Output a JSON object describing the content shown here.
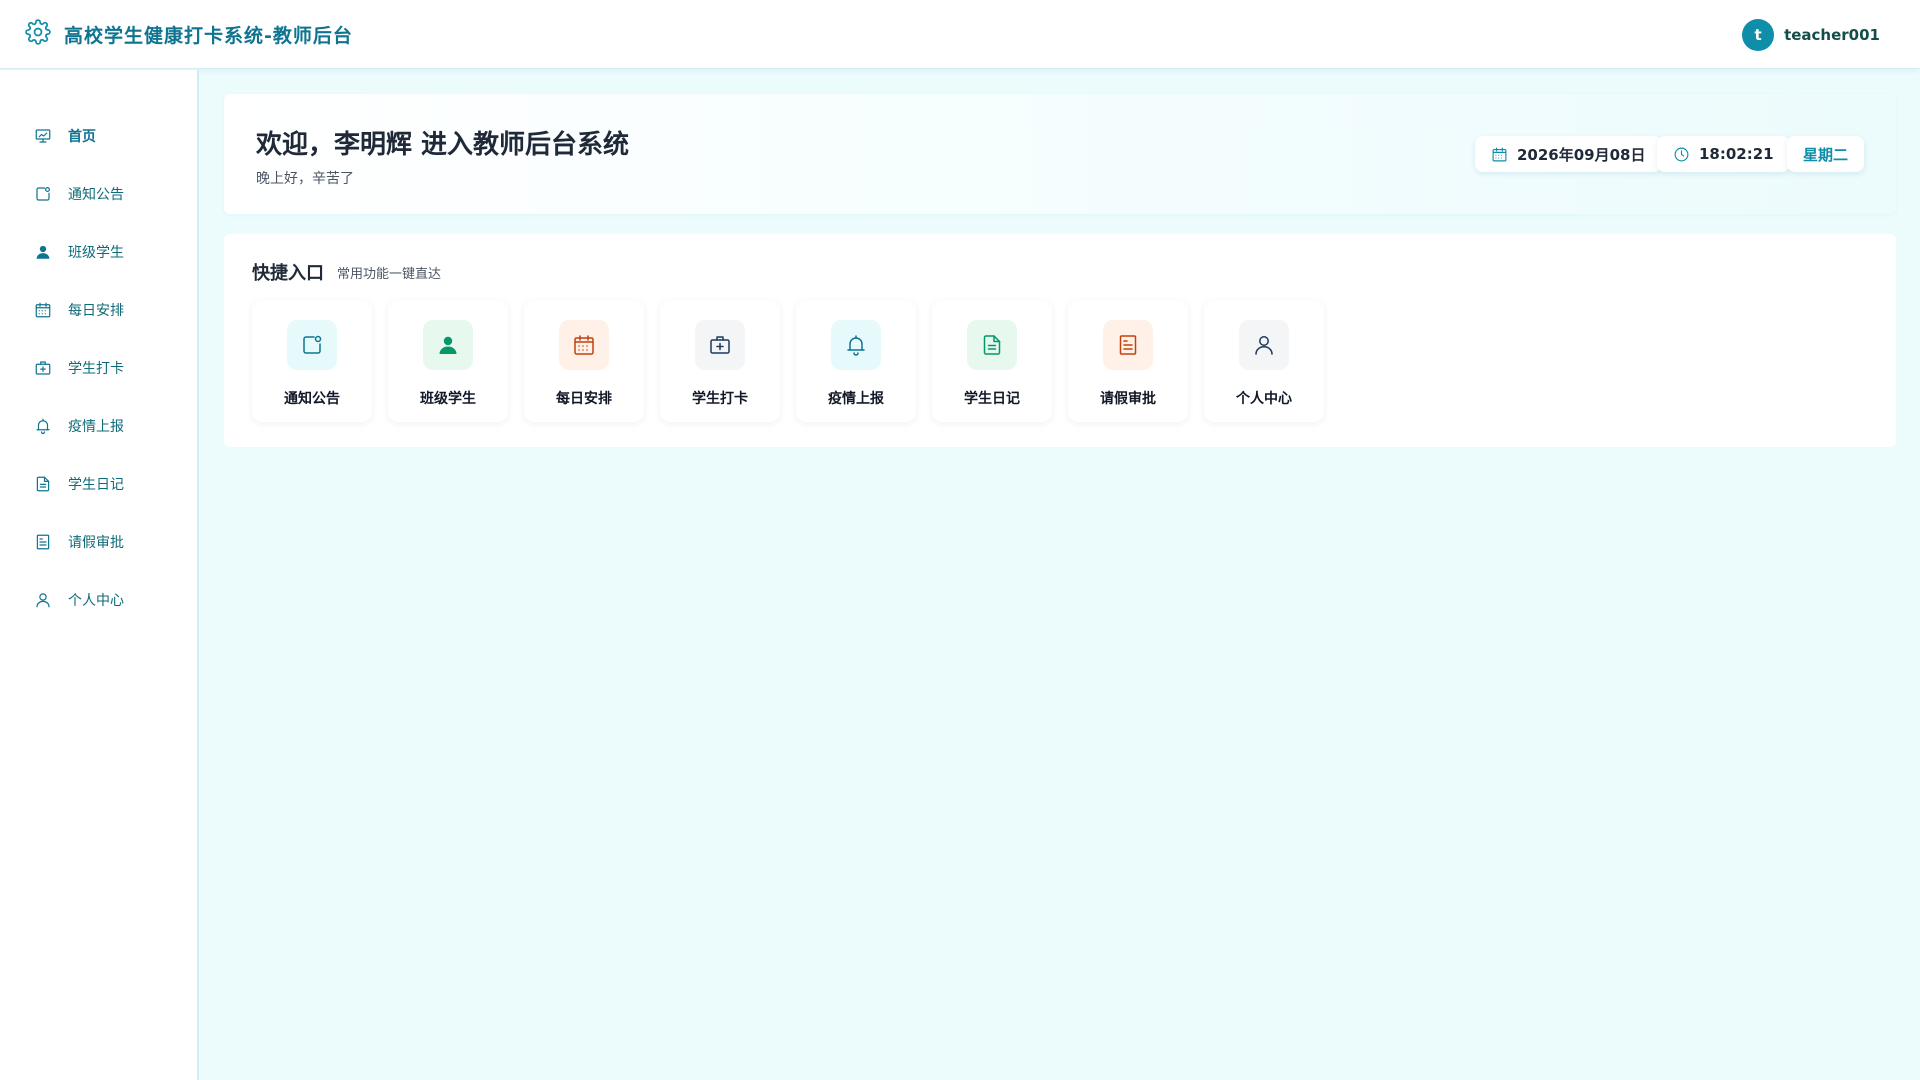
{
  "header": {
    "title": "高校学生健康打卡系统-教师后台",
    "brand_icon": "gear-icon",
    "brand_color": "#0e7490",
    "user": {
      "avatar_letter": "t",
      "name": "teacher001",
      "avatar_color": "#0e8ea8"
    }
  },
  "sidebar": {
    "items": [
      {
        "label": "首页",
        "icon": "dashboard-icon",
        "active": true
      },
      {
        "label": "通知公告",
        "icon": "notice-icon"
      },
      {
        "label": "班级学生",
        "icon": "user-solid-icon"
      },
      {
        "label": "每日安排",
        "icon": "calendar-icon"
      },
      {
        "label": "学生打卡",
        "icon": "first-aid-kit-icon"
      },
      {
        "label": "疫情上报",
        "icon": "bell-icon"
      },
      {
        "label": "学生日记",
        "icon": "document-icon"
      },
      {
        "label": "请假审批",
        "icon": "tickets-icon"
      },
      {
        "label": "个人中心",
        "icon": "user-icon"
      }
    ]
  },
  "welcome": {
    "title": "欢迎，李明辉 进入教师后台系统",
    "subtitle": "晚上好，辛苦了",
    "date": "2026年09月08日",
    "time": "18:02:21",
    "weekday": "星期二"
  },
  "quick": {
    "title": "快捷入口",
    "subtitle": "常用功能一键直达",
    "tiles": [
      {
        "label": "通知公告",
        "icon": "notice-icon",
        "color": "#0e7490",
        "bg": "#e6fafc"
      },
      {
        "label": "班级学生",
        "icon": "user-solid-icon",
        "color": "#059669",
        "bg": "#e7f8ef"
      },
      {
        "label": "每日安排",
        "icon": "calendar-icon",
        "color": "#c2410c",
        "bg": "#fff1e8"
      },
      {
        "label": "学生打卡",
        "icon": "first-aid-kit-icon",
        "color": "#1e3a5f",
        "bg": "#f3f5f7"
      },
      {
        "label": "疫情上报",
        "icon": "bell-icon",
        "color": "#0e7490",
        "bg": "#e6fafc"
      },
      {
        "label": "学生日记",
        "icon": "document-icon",
        "color": "#059669",
        "bg": "#e7f8ef"
      },
      {
        "label": "请假审批",
        "icon": "tickets-icon",
        "color": "#c2410c",
        "bg": "#fff1e8"
      },
      {
        "label": "个人中心",
        "icon": "user-icon",
        "color": "#1e3a5f",
        "bg": "#f3f5f7"
      }
    ]
  }
}
